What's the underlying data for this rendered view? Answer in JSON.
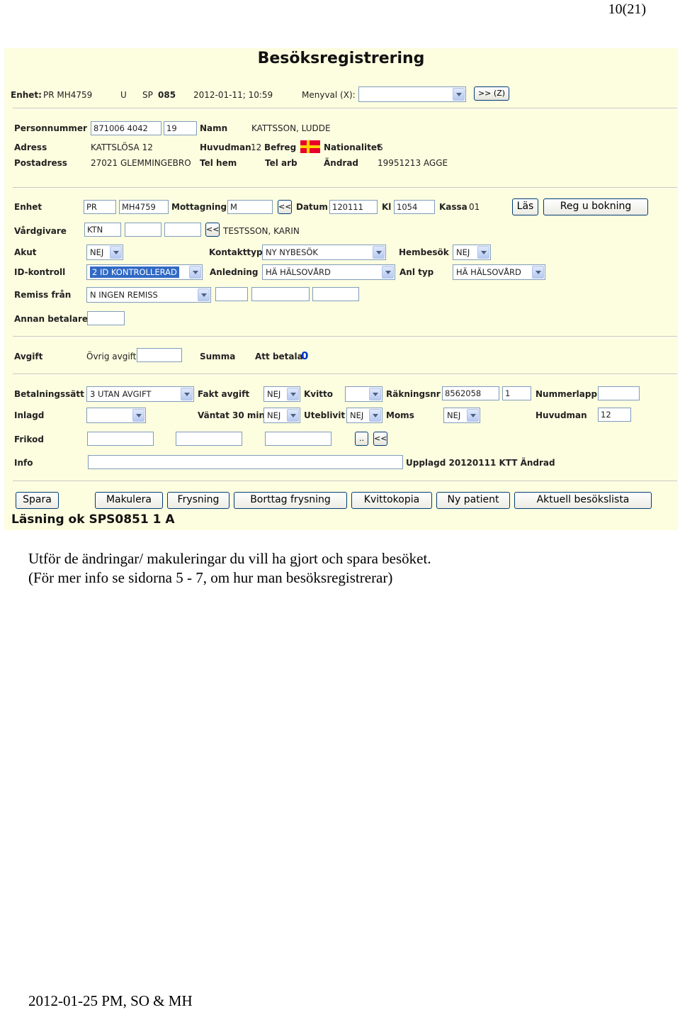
{
  "page_number": "10(21)",
  "form": {
    "title": "Besöksregistrering",
    "top": {
      "enhet_label": "Enhet:",
      "enhet_value": "PR MH4759",
      "u": "U",
      "sp_label": "SP",
      "sp_value": "085",
      "datetime": "2012-01-11; 10:59",
      "menyval_label": "Menyval (X):",
      "menyval_value": "",
      "go_button": ">> (Z)"
    },
    "patient": {
      "personnummer_label": "Personnummer",
      "personnummer_value": "871006 4042",
      "personnummer_suffix": "19",
      "namn_label": "Namn",
      "namn_value": "KATTSSON, LUDDE",
      "adress_label": "Adress",
      "adress_value": "KATTSLÖSA 12",
      "huvudman_label": "Huvudman",
      "huvudman_value": "12",
      "befreg_label": "Befreg",
      "nationalitet_label": "Nationalitet",
      "nationalitet_value": "S",
      "postadress_label": "Postadress",
      "postadress_value": "27021  GLEMMINGEBRO",
      "telhem_label": "Tel hem",
      "telarb_label": "Tel arb",
      "andrad_label": "Ändrad",
      "andrad_value": "19951213 AGGE"
    },
    "visit": {
      "enhet_label": "Enhet",
      "enhet_1": "PR",
      "enhet_2": "MH4759",
      "mottagning_label": "Mottagning",
      "mottagning_value": "M",
      "back_btn": "<<",
      "datum_label": "Datum",
      "datum_value": "120111",
      "kl_label": "Kl",
      "kl_value": "1054",
      "kassa_label": "Kassa",
      "kassa_value": "01",
      "las_btn": "Läs",
      "reg_btn": "Reg u bokning",
      "vardgivare_label": "Vårdgivare",
      "vardgivare_value": "KTN",
      "vardgivare_back_btn": "<<",
      "vardgivare_name": "TESTSSON, KARIN",
      "akut_label": "Akut",
      "akut_value": "NEJ",
      "kontakttyp_label": "Kontakttyp",
      "kontakttyp_value": "NY NYBESÖK",
      "hembesok_label": "Hembesök",
      "hembesok_value": "NEJ",
      "idkontroll_label": "ID-kontroll",
      "idkontroll_value": "2 ID KONTROLLERAD",
      "anledning_label": "Anledning",
      "anledning_value": "HÄ HÄLSOVÅRD",
      "anltyp_label": "Anl typ",
      "anltyp_value": "HÄ HÄLSOVÅRD",
      "remiss_label": "Remiss från",
      "remiss_value": "N INGEN REMISS",
      "annan_label": "Annan betalare"
    },
    "fee": {
      "avgift_label": "Avgift",
      "ovrig_label": "Övrig avgift",
      "summa_label": "Summa",
      "attbetala_label": "Att betala",
      "attbetala_value": "0"
    },
    "payment": {
      "betalningssatt_label": "Betalningssätt",
      "betalningssatt_value": "3 UTAN AVGIFT",
      "faktavgift_label": "Fakt avgift",
      "faktavgift_value": "NEJ",
      "kvitto_label": "Kvitto",
      "kvitto_value": "",
      "rakningsnr_label": "Räkningsnr",
      "rakningsnr_value": "8562058",
      "rakningsnr_suffix": "1",
      "nummerlapp_label": "Nummerlapp",
      "inlagd_label": "Inlagd",
      "vantat_label": "Väntat 30 min",
      "vantat_value": "NEJ",
      "uteblivit_label": "Uteblivit",
      "uteblivit_value": "NEJ",
      "moms_label": "Moms",
      "moms_value": "NEJ",
      "huvudman_label": "Huvudman",
      "huvudman_value": "12",
      "frikod_label": "Frikod",
      "dots_btn": "..",
      "back_btn": "<<",
      "info_label": "Info",
      "upplagd_text": "Upplagd 20120111 KTT Ändrad"
    },
    "buttons": {
      "spara": "Spara",
      "makulera": "Makulera",
      "frysning": "Frysning",
      "borttag": "Borttag frysning",
      "kvittokopia": "Kvittokopia",
      "nypatient": "Ny patient",
      "aktuell": "Aktuell besökslista"
    },
    "status": "Läsning ok SPS0851 1 A"
  },
  "caption_line1": "Utför de ändringar/ makuleringar du vill ha gjort och spara besöket.",
  "caption_line2": "(För mer info se sidorna 5 - 7, om hur man besöksregistrerar)",
  "footer": "2012-01-25 PM, SO & MH",
  "colors": {
    "panel_bg": "#fdfde0",
    "field_border": "#7f9db9",
    "selection": "#316ac5",
    "flag_red": "#e8002a",
    "flag_yellow": "#ffd200"
  }
}
